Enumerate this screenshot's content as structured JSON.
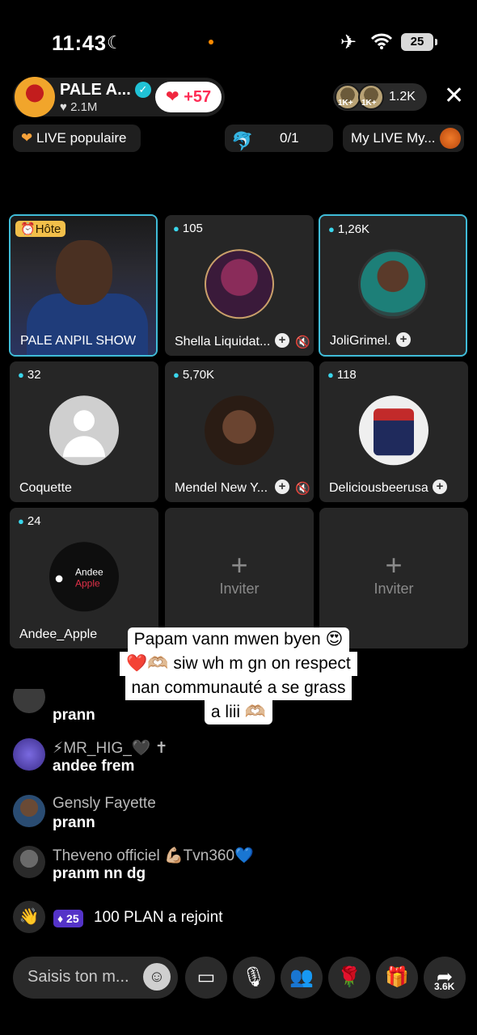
{
  "status_bar": {
    "time": "11:43",
    "battery": "25"
  },
  "top_bar": {
    "host_name": "PALE A...",
    "host_likes": "2.1M",
    "hearts": "+57",
    "viewer_badge_1": "1K+",
    "viewer_badge_2": "1K+",
    "viewer_count": "1.2K",
    "live_popular": "LIVE populaire",
    "goal": "0/1",
    "my_live": "My LIVE My..."
  },
  "tiles": [
    {
      "badge": "Hôte",
      "name": "PALE ANPIL SHOW"
    },
    {
      "viewers": "105",
      "name": "Shella Liquidat..."
    },
    {
      "viewers": "1,26K",
      "name": "JoliGrimel."
    },
    {
      "viewers": "32",
      "name": "Coquette"
    },
    {
      "viewers": "5,70K",
      "name": "Mendel New Y..."
    },
    {
      "viewers": "118",
      "name": "Deliciousbeerusa"
    },
    {
      "viewers": "24",
      "name": "Andee_Apple",
      "logo_line1": "Andee",
      "logo_line2": "Apple"
    },
    {
      "invite": "Inviter"
    },
    {
      "invite": "Inviter"
    }
  ],
  "caption": {
    "line1": "Papam vann mwen byen 😍",
    "line2": "❤️🫶🏼 siw wh m gn on respect",
    "line3": "nan communauté a se grass",
    "line4": "a liii 🫶🏼"
  },
  "comments": [
    {
      "user": "",
      "text": "prann"
    },
    {
      "user": "⚡MR_HIG_🖤 ✝",
      "text": "andee frem"
    },
    {
      "user": "Gensly Fayette",
      "text": "prann"
    },
    {
      "user": "Theveno officiel  💪🏼Tvn360💙",
      "text": "pranm nn dg"
    }
  ],
  "joined": {
    "level": "25",
    "text": "100 PLAN a rejoint"
  },
  "bottom_bar": {
    "placeholder": "Saisis ton m...",
    "share_count": "3.6K"
  }
}
